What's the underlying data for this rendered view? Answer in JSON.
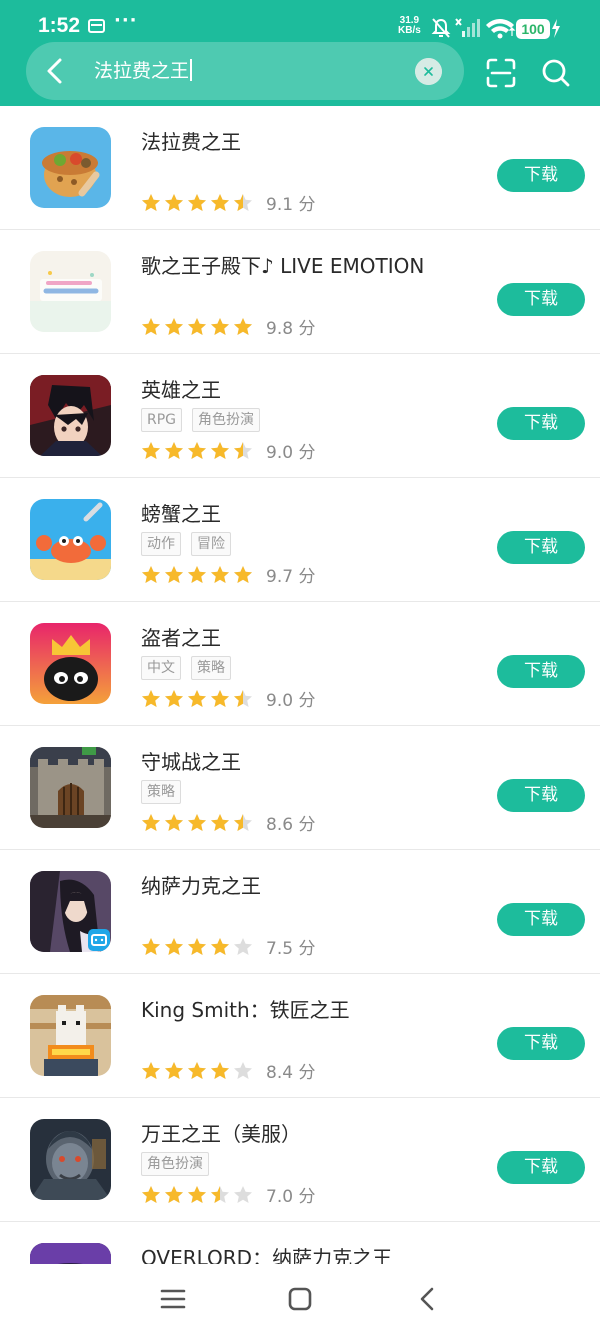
{
  "status_bar": {
    "time": "1:52",
    "dots": "···",
    "speed_value": "31.9",
    "speed_unit": "KB/s",
    "battery": "100"
  },
  "search": {
    "query": "法拉费之王"
  },
  "colors": {
    "accent": "#1dbc9c",
    "star": "#f7b92a",
    "star_empty": "#dddddd"
  },
  "apps": [
    {
      "name": "法拉费之王",
      "tags": [],
      "stars": 4.5,
      "score": "9.1 分",
      "download": "下载"
    },
    {
      "name": "歌之王子殿下♪ LIVE EMOTION",
      "tags": [],
      "stars": 5,
      "score": "9.8 分",
      "download": "下载"
    },
    {
      "name": "英雄之王",
      "tags": [
        "RPG",
        "角色扮演"
      ],
      "stars": 4.5,
      "score": "9.0 分",
      "download": "下载"
    },
    {
      "name": "螃蟹之王",
      "tags": [
        "动作",
        "冒险"
      ],
      "stars": 5,
      "score": "9.7 分",
      "download": "下载"
    },
    {
      "name": "盗者之王",
      "tags": [
        "中文",
        "策略"
      ],
      "stars": 4.5,
      "score": "9.0 分",
      "download": "下载"
    },
    {
      "name": "守城战之王",
      "tags": [
        "策略"
      ],
      "stars": 4.5,
      "score": "8.6 分",
      "download": "下载"
    },
    {
      "name": "纳萨力克之王",
      "tags": [],
      "stars": 4,
      "score": "7.5 分",
      "download": "下载"
    },
    {
      "name": "King Smith：铁匠之王",
      "tags": [],
      "stars": 4,
      "score": "8.4 分",
      "download": "下载"
    },
    {
      "name": "万王之王（美服）",
      "tags": [
        "角色扮演"
      ],
      "stars": 3.5,
      "score": "7.0 分",
      "download": "下载"
    },
    {
      "name": "OVERLORD：纳萨力克之王",
      "tags": [],
      "stars": 0,
      "score": "",
      "download": ""
    }
  ]
}
